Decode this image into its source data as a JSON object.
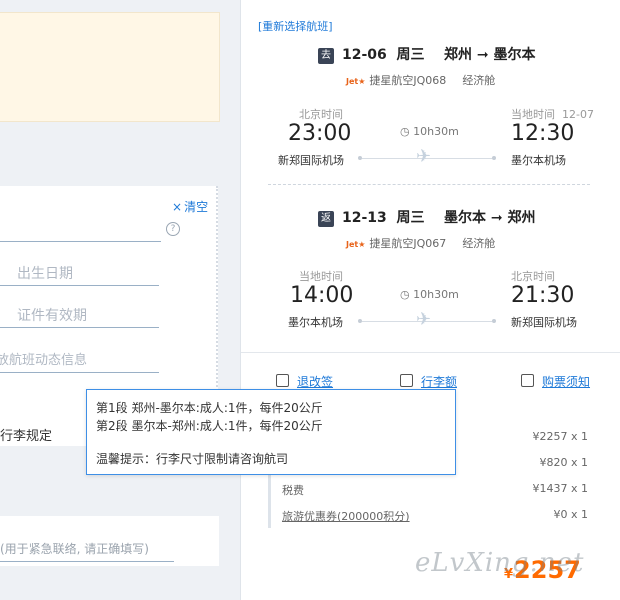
{
  "form": {
    "clear_label": "清空",
    "birth_placeholder": "出生日期",
    "id_expiry_placeholder": "证件有效期",
    "flight_info_placeholder": "放航班动态信息",
    "luggage_label": "行李规定",
    "contact_placeholder": "(用于紧急联络, 请正确填写)"
  },
  "tooltip": {
    "line1": "第1段 郑州-墨尔本:成人:1件，每件20公斤",
    "line2": "第2段 墨尔本-郑州:成人:1件，每件20公斤",
    "hint": "温馨提示：行李尺寸限制请咨询航司"
  },
  "panel": {
    "reselect": "[重新选择航班]",
    "outbound": {
      "badge": "去",
      "date": "12-06",
      "weekday": "周三",
      "from_city": "郑州",
      "to_city": "墨尔本",
      "airline": "捷星航空JQ068",
      "cabin": "经济舱",
      "dep_zone": "北京时间",
      "arr_zone": "当地时间",
      "arr_date": "12-07",
      "dep_time": "23:00",
      "arr_time": "12:30",
      "duration": "10h30m",
      "dep_airport": "新郑国际机场",
      "arr_airport": "墨尔本机场"
    },
    "inbound": {
      "badge": "返",
      "date": "12-13",
      "weekday": "周三",
      "from_city": "墨尔本",
      "to_city": "郑州",
      "airline": "捷星航空JQ067",
      "cabin": "经济舱",
      "dep_zone": "当地时间",
      "arr_zone": "北京时间",
      "dep_time": "14:00",
      "arr_time": "21:30",
      "duration": "10h30m",
      "dep_airport": "墨尔本机场",
      "arr_airport": "新郑国际机场"
    },
    "links": {
      "refund": "退改签",
      "baggage": "行李额",
      "notice": "购票须知"
    },
    "prices": [
      {
        "label": "",
        "amount": "¥2257 x 1"
      },
      {
        "label": "",
        "amount": "¥820 x 1"
      },
      {
        "label": "税费",
        "amount": "¥1437 x 1"
      },
      {
        "label": "旅游优惠券(200000积分)",
        "amount": "¥0 x 1"
      }
    ],
    "total_currency": "¥",
    "total_amount": "2257",
    "watermark": "eLvXing.net",
    "colors": {
      "accent": "#1f7ad8",
      "price": "#ff6a00"
    }
  }
}
